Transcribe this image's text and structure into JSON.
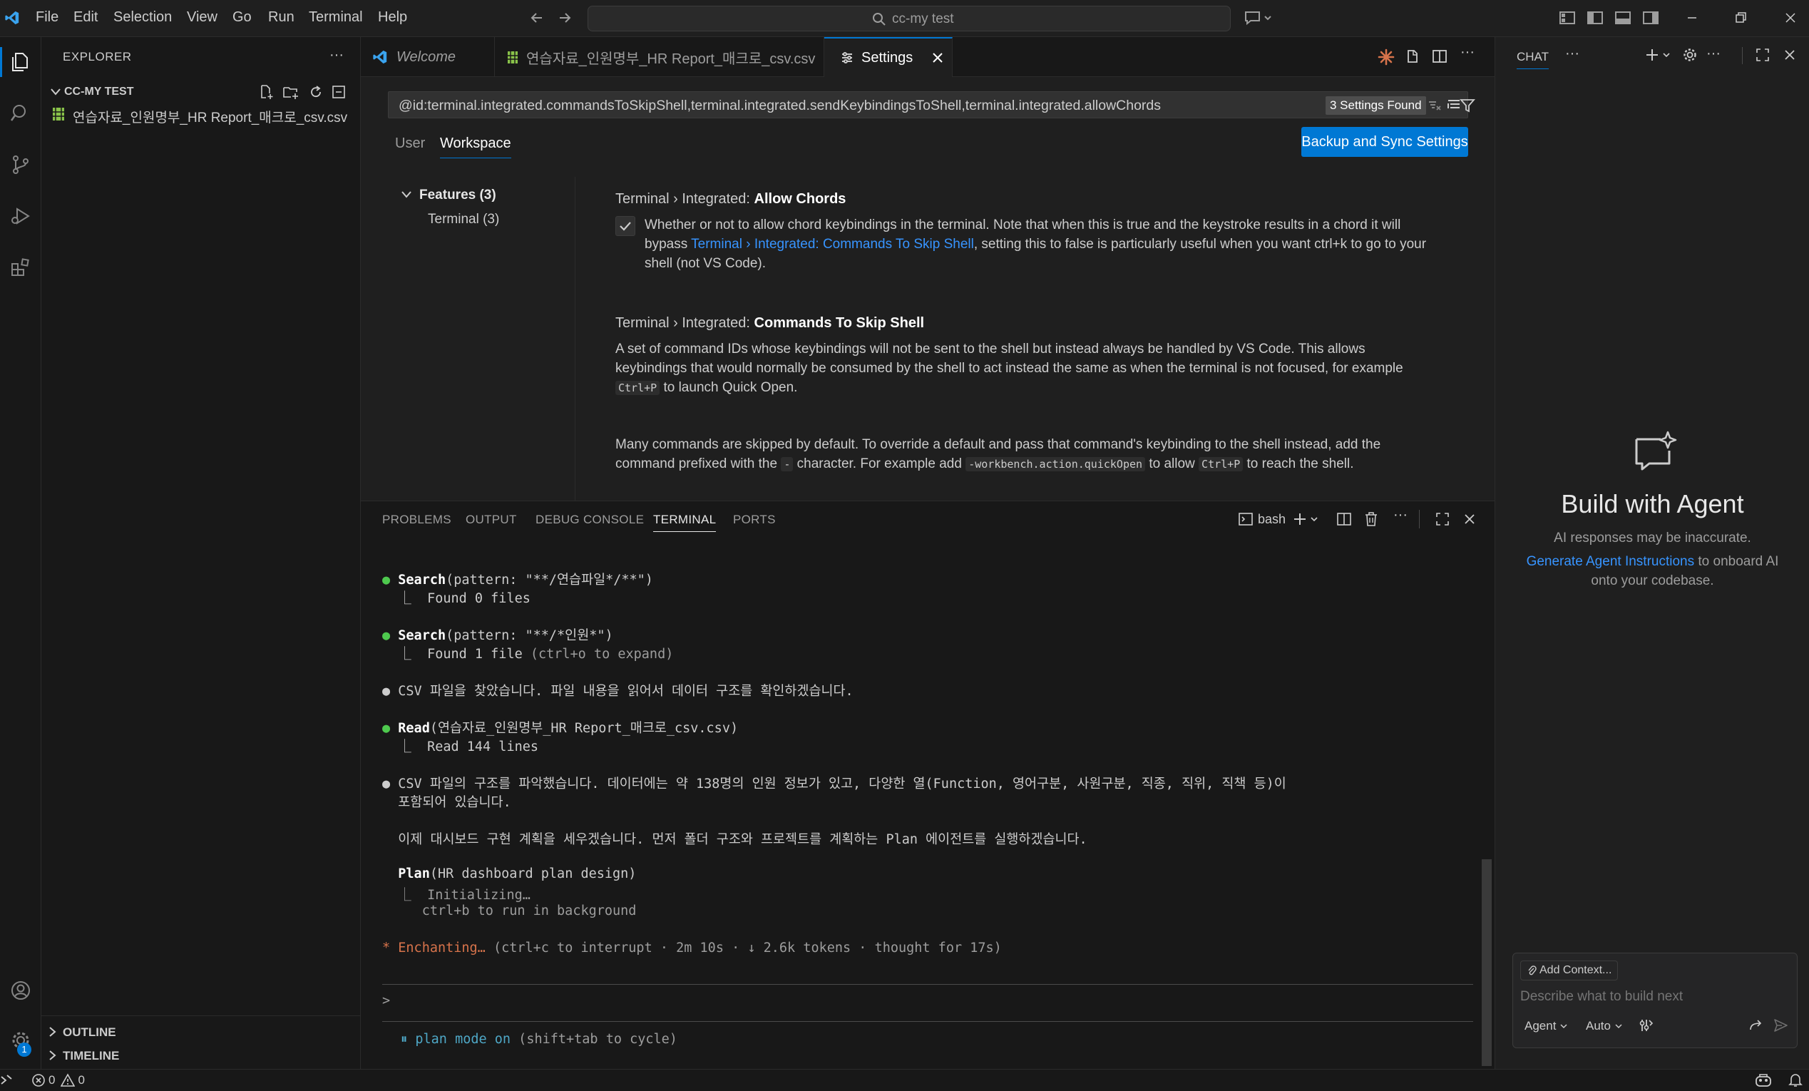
{
  "menu": [
    "File",
    "Edit",
    "Selection",
    "View",
    "Go",
    "Run",
    "Terminal",
    "Help"
  ],
  "command_center": {
    "text": "cc-my test"
  },
  "explorer": {
    "title": "EXPLORER",
    "folder": "CC-MY TEST",
    "files": [
      "연습자료_인원명부_HR Report_매크로_csv.csv"
    ],
    "outline": "OUTLINE",
    "timeline": "TIMELINE"
  },
  "tabs": [
    {
      "label": "Welcome"
    },
    {
      "label": "연습자료_인원명부_HR Report_매크로_csv.csv"
    },
    {
      "label": "Settings"
    }
  ],
  "settings": {
    "query": "@id:terminal.integrated.commandsToSkipShell,terminal.integrated.sendKeybindingsToShell,terminal.integrated.allowChords",
    "found": "3 Settings Found",
    "scope_user": "User",
    "scope_workspace": "Workspace",
    "sync_button": "Backup and Sync Settings",
    "toc_features": "Features (3)",
    "toc_terminal": "Terminal (3)",
    "s1_prefix": "Terminal › Integrated: ",
    "s1_name": "Allow Chords",
    "s1_desc_a": "Whether or not to allow chord keybindings in the terminal. Note that when this is true and the keystroke results in a chord it will",
    "s1_desc_b_pre": "bypass ",
    "s1_desc_b_link": "Terminal › Integrated: Commands To Skip Shell",
    "s1_desc_b_post": ", setting this to false is particularly useful when you want ctrl+k to go to your",
    "s1_desc_c": "shell (not VS Code).",
    "s2_prefix": "Terminal › Integrated: ",
    "s2_name": "Commands To Skip Shell",
    "s2_desc_a": "A set of command IDs whose keybindings will not be sent to the shell but instead always be handled by VS Code. This allows",
    "s2_desc_b": "keybindings that would normally be consumed by the shell to act instead the same as when the terminal is not focused, for example",
    "s2_desc_c_code": "Ctrl+P",
    "s2_desc_c_post": " to launch Quick Open.",
    "s2_more_a": "Many commands are skipped by default. To override a default and pass that command's keybinding to the shell instead, add the",
    "s2_more_b_pre": "command prefixed with the ",
    "s2_more_b_code1": "-",
    "s2_more_b_mid": " character. For example add ",
    "s2_more_b_code2": "-workbench.action.quickOpen",
    "s2_more_b_mid2": " to allow ",
    "s2_more_b_code3": "Ctrl+P",
    "s2_more_b_post": " to reach the shell."
  },
  "panel": {
    "tabs": [
      "PROBLEMS",
      "OUTPUT",
      "DEBUG CONSOLE",
      "TERMINAL",
      "PORTS"
    ],
    "shell": "bash"
  },
  "terminal": {
    "l1_tool": "Search",
    "l1_args": "(pattern: \"**/연습파일*/**\")",
    "l1_res_pre": "⎿  ",
    "l1_res": "Found 0 files",
    "l2_tool": "Search",
    "l2_args": "(pattern: \"**/*인원*\")",
    "l2_res": "Found 1 file",
    "l2_res_dim": " (ctrl+o to expand)",
    "l3": "CSV 파일을 찾았습니다. 파일 내용을 읽어서 데이터 구조를 확인하겠습니다.",
    "l4_tool": "Read",
    "l4_args": "(연습자료_인원명부_HR Report_매크로_csv.csv)",
    "l4_res": "Read 144 lines",
    "l5a": "CSV 파일의 구조를 파악했습니다. 데이터에는 약 138명의 인원 정보가 있고, 다양한 열(Function, 영어구분, 사원구분, 직종, 직위, 직책 등)이",
    "l5b": "포함되어 있습니다.",
    "l6": "이제 대시보드 구현 계획을 세우겠습니다. 먼저 폴더 구조와 프로젝트를 계획하는 Plan 에이전트를 실행하겠습니다.",
    "l7_tool": "Plan",
    "l7_args": "(HR dashboard plan design)",
    "l7_res": "Initializing…",
    "l7_res2": "ctrl+b to run in background",
    "l8_status": "Enchanting…",
    "l8_rest": " (ctrl+c to interrupt · 2m 10s · ↓ 2.6k tokens · thought for 17s)",
    "prompt": ">",
    "mode_text": "⏸ plan mode on",
    "mode_hint": " (shift+tab to cycle)"
  },
  "chat": {
    "title": "CHAT",
    "heading": "Build with Agent",
    "note": "AI responses may be inaccurate.",
    "link": "Generate Agent Instructions",
    "link_post": " to onboard AI",
    "line3": "onto your codebase.",
    "add_context": "Add Context...",
    "placeholder": "Describe what to build next",
    "mode": "Agent",
    "model": "Auto"
  },
  "status": {
    "errors": "0",
    "warnings": "0",
    "accounts_badge": "1"
  },
  "colors": {
    "accent": "#0078d4",
    "link": "#3794ff",
    "bullet_green": "#4ec94e",
    "status_orange": "#d7734b",
    "csv_icon": "#89c24a"
  }
}
